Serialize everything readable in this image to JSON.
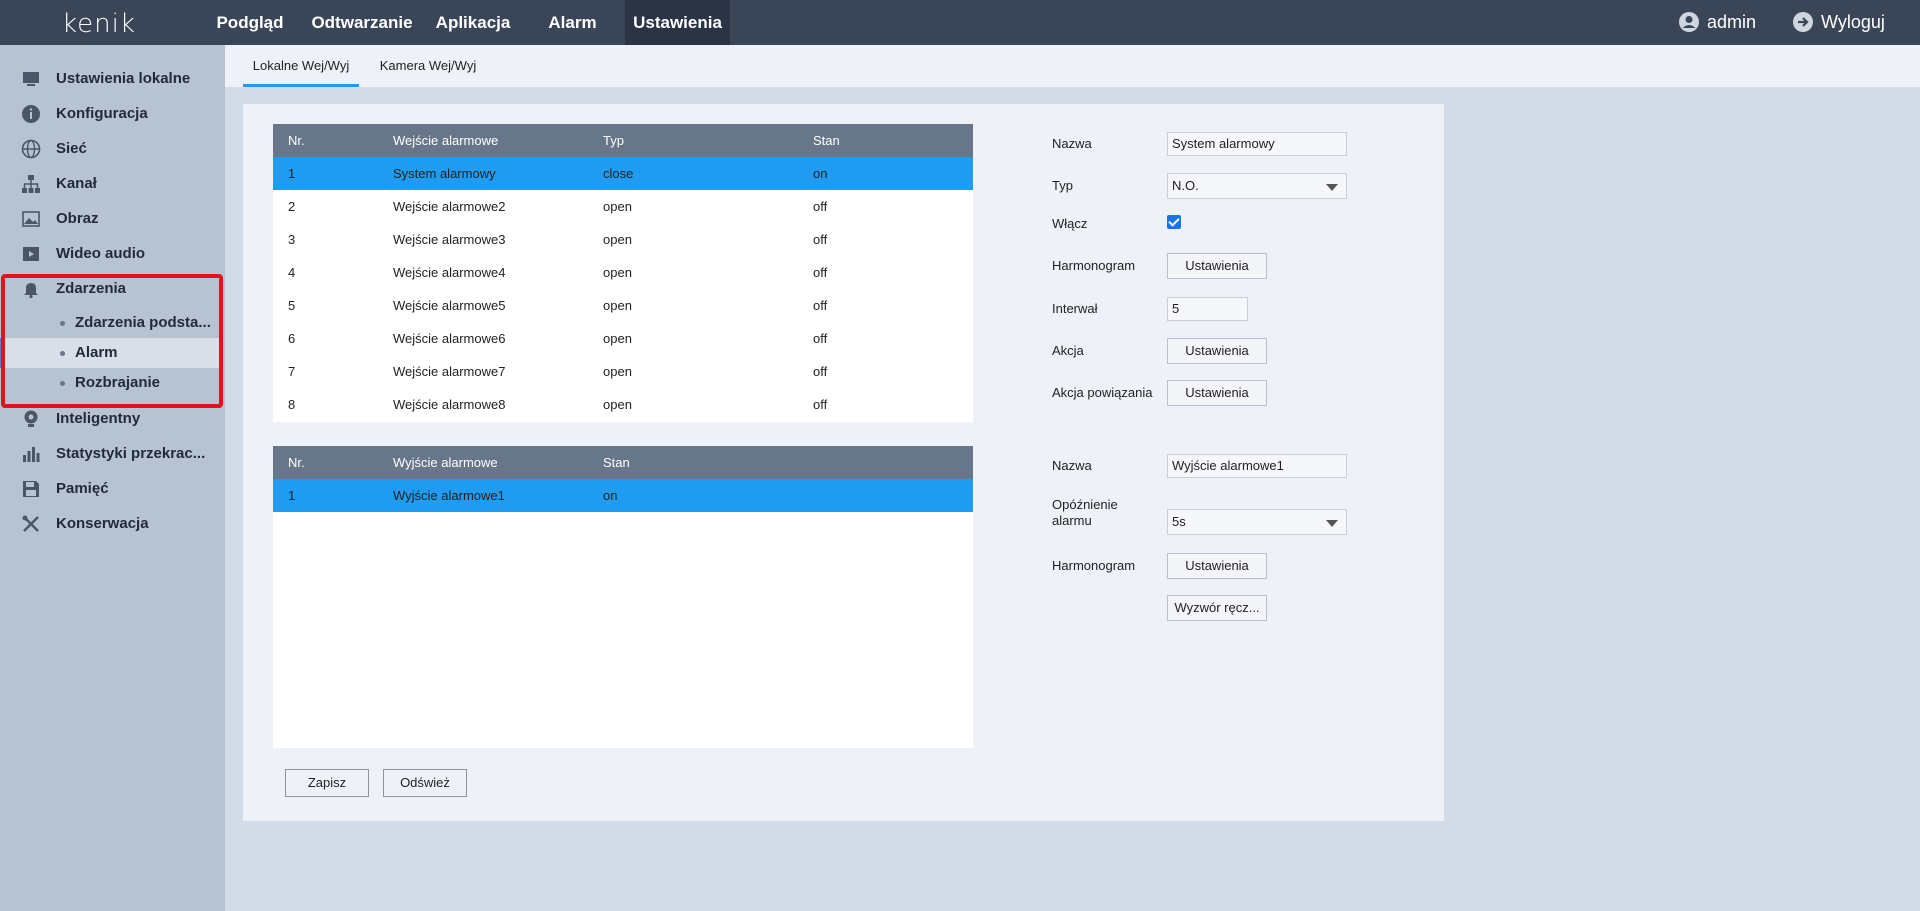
{
  "header": {
    "logo": "kenik",
    "nav": [
      "Podgląd",
      "Odtwarzanie",
      "Aplikacja",
      "Alarm",
      "Ustawienia"
    ],
    "active_nav": "Ustawienia",
    "user": "admin",
    "logout": "Wyloguj"
  },
  "sidebar": {
    "items": [
      {
        "label": "Ustawienia lokalne",
        "icon": "monitor-icon"
      },
      {
        "label": "Konfiguracja",
        "icon": "info-icon"
      },
      {
        "label": "Sieć",
        "icon": "globe-icon"
      },
      {
        "label": "Kanał",
        "icon": "network-tree-icon"
      },
      {
        "label": "Obraz",
        "icon": "image-icon"
      },
      {
        "label": "Wideo audio",
        "icon": "video-icon"
      },
      {
        "label": "Zdarzenia",
        "icon": "bell-icon"
      },
      {
        "label": "Inteligentny",
        "icon": "camera-icon"
      },
      {
        "label": "Statystyki przekrac...",
        "icon": "bar-chart-icon"
      },
      {
        "label": "Pamięć",
        "icon": "floppy-icon"
      },
      {
        "label": "Konserwacja",
        "icon": "tools-icon"
      }
    ],
    "subitems": [
      "Zdarzenia podsta...",
      "Alarm",
      "Rozbrajanie"
    ],
    "active_subitem": "Alarm"
  },
  "tabs": [
    "Lokalne Wej/Wyj",
    "Kamera Wej/Wyj"
  ],
  "active_tab": "Lokalne Wej/Wyj",
  "inputs_table": {
    "headers": [
      "Nr.",
      "Wejście alarmowe",
      "Typ",
      "Stan"
    ],
    "rows": [
      [
        "1",
        "System alarmowy",
        "close",
        "on"
      ],
      [
        "2",
        "Wejście alarmowe2",
        "open",
        "off"
      ],
      [
        "3",
        "Wejście alarmowe3",
        "open",
        "off"
      ],
      [
        "4",
        "Wejście alarmowe4",
        "open",
        "off"
      ],
      [
        "5",
        "Wejście alarmowe5",
        "open",
        "off"
      ],
      [
        "6",
        "Wejście alarmowe6",
        "open",
        "off"
      ],
      [
        "7",
        "Wejście alarmowe7",
        "open",
        "off"
      ],
      [
        "8",
        "Wejście alarmowe8",
        "open",
        "off"
      ]
    ],
    "selected_row": 0
  },
  "outputs_table": {
    "headers": [
      "Nr.",
      "Wyjście alarmowe",
      "Stan"
    ],
    "rows": [
      [
        "1",
        "Wyjście alarmowe1",
        "on"
      ]
    ],
    "selected_row": 0
  },
  "input_form": {
    "name_label": "Nazwa",
    "name_value": "System alarmowy",
    "type_label": "Typ",
    "type_value": "N.O.",
    "enable_label": "Włącz",
    "enabled": true,
    "schedule_label": "Harmonogram",
    "schedule_button": "Ustawienia",
    "interval_label": "Interwał",
    "interval_value": "5",
    "action_label": "Akcja",
    "action_button": "Ustawienia",
    "linkage_label": "Akcja powiązania",
    "linkage_button": "Ustawienia"
  },
  "output_form": {
    "name_label": "Nazwa",
    "name_value": "Wyjście alarmowe1",
    "delay_label": "Opóźnienie alarmu",
    "delay_value": "5s",
    "schedule_label": "Harmonogram",
    "schedule_button": "Ustawienia",
    "manual_trigger_button": "Wyzwór ręcz..."
  },
  "buttons": {
    "save": "Zapisz",
    "refresh": "Odśwież"
  },
  "colors": {
    "topbar": "#3a4658",
    "sidebar": "#b8c3d1",
    "selected_row": "#1f9bf0",
    "highlight": "#e0141e"
  }
}
